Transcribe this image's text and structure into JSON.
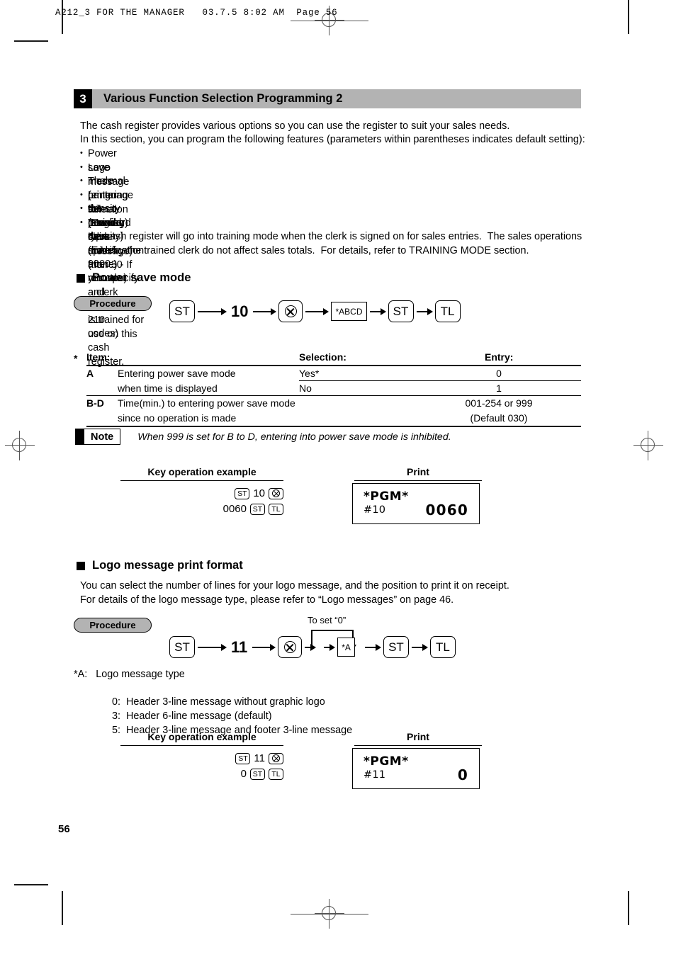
{
  "doc_header": "A212_3 FOR THE MANAGER   03.7.5 8:02 AM  Page 56",
  "page_number": "56",
  "section": {
    "number": "3",
    "title": "Various Function Selection Programming 2",
    "intro_line1": "The cash register provides various options so you can use the register to suit your sales needs.",
    "intro_line2": "In this section, you can program the following features (parameters within parentheses indicates default setting):",
    "features": [
      "Power save mode (entering the power save mode after 30 minutes)",
      "Logo message print format (Header 6-line message)",
      "Thermal printer density (standard density)",
      "Language selection (English)",
      "EJ memory type (EJ 9000 records and PLU 210 codes)",
      "Training clerk specification (none) - If you specify a clerk number who is trained for use on this cash register,"
    ],
    "feature_cont_line1": "the cash register will go into training mode when the clerk is signed on for sales entries.  The sales operations",
    "feature_cont_line2": "done by the trained clerk do not affect sales totals.  For details, refer to TRAINING MODE section."
  },
  "power_save": {
    "heading": "Power save mode",
    "procedure_label": "Procedure",
    "flow": {
      "k1": "ST",
      "n1": "10",
      "k2": "multiply-icon",
      "param": "*ABCD",
      "k3": "ST",
      "k4": "TL"
    },
    "table": {
      "asterisk": "*",
      "headers": [
        "Item:",
        "Selection:",
        "Entry:"
      ],
      "rows": [
        {
          "item": "A",
          "desc_line1": "Entering power save mode",
          "desc_line2": "when time is displayed",
          "selection_1": "Yes*",
          "entry_1": "0",
          "selection_2": "No",
          "entry_2": "1"
        },
        {
          "item": "B-D",
          "desc_line1": "Time(min.) to entering power save mode",
          "desc_line2": "since no operation is made",
          "selection_1": "",
          "entry_1": "001-254 or 999",
          "selection_2": "",
          "entry_2": "(Default 030)"
        }
      ]
    },
    "note": {
      "label": "Note",
      "text": "When 999 is set for B to D, entering into power save mode is inhibited."
    },
    "example": {
      "key_header": "Key operation example",
      "print_header": "Print",
      "line1_keys": [
        "ST",
        "10",
        "multiply-icon"
      ],
      "line2_keys": [
        "0060",
        "ST",
        "TL"
      ],
      "receipt_title": "*PGM*",
      "receipt_code": "#10",
      "receipt_value": "0060"
    }
  },
  "logo_format": {
    "heading": "Logo message print format",
    "intro_line1": "You can select the number of lines for your logo message, and the position to print it on receipt.",
    "intro_line2": "For details of the logo message type, please refer to “Logo messages” on page 46.",
    "procedure_label": "Procedure",
    "loop_label": "To set “0”",
    "flow": {
      "k1": "ST",
      "n1": "11",
      "k2": "multiply-icon",
      "param": "*A",
      "k3": "ST",
      "k4": "TL"
    },
    "types_label": "*A:   Logo message type",
    "types": [
      {
        "code": "0:",
        "desc": "Header 3-line message without graphic logo"
      },
      {
        "code": "3:",
        "desc": "Header 6-line message (default)"
      },
      {
        "code": "5:",
        "desc": "Header 3-line message and footer 3-line message"
      }
    ],
    "example": {
      "key_header": "Key operation example",
      "print_header": "Print",
      "line1_keys": [
        "ST",
        "11",
        "multiply-icon"
      ],
      "line2_keys": [
        "0",
        "ST",
        "TL"
      ],
      "receipt_title": "*PGM*",
      "receipt_code": "#11",
      "receipt_value": "0"
    }
  }
}
